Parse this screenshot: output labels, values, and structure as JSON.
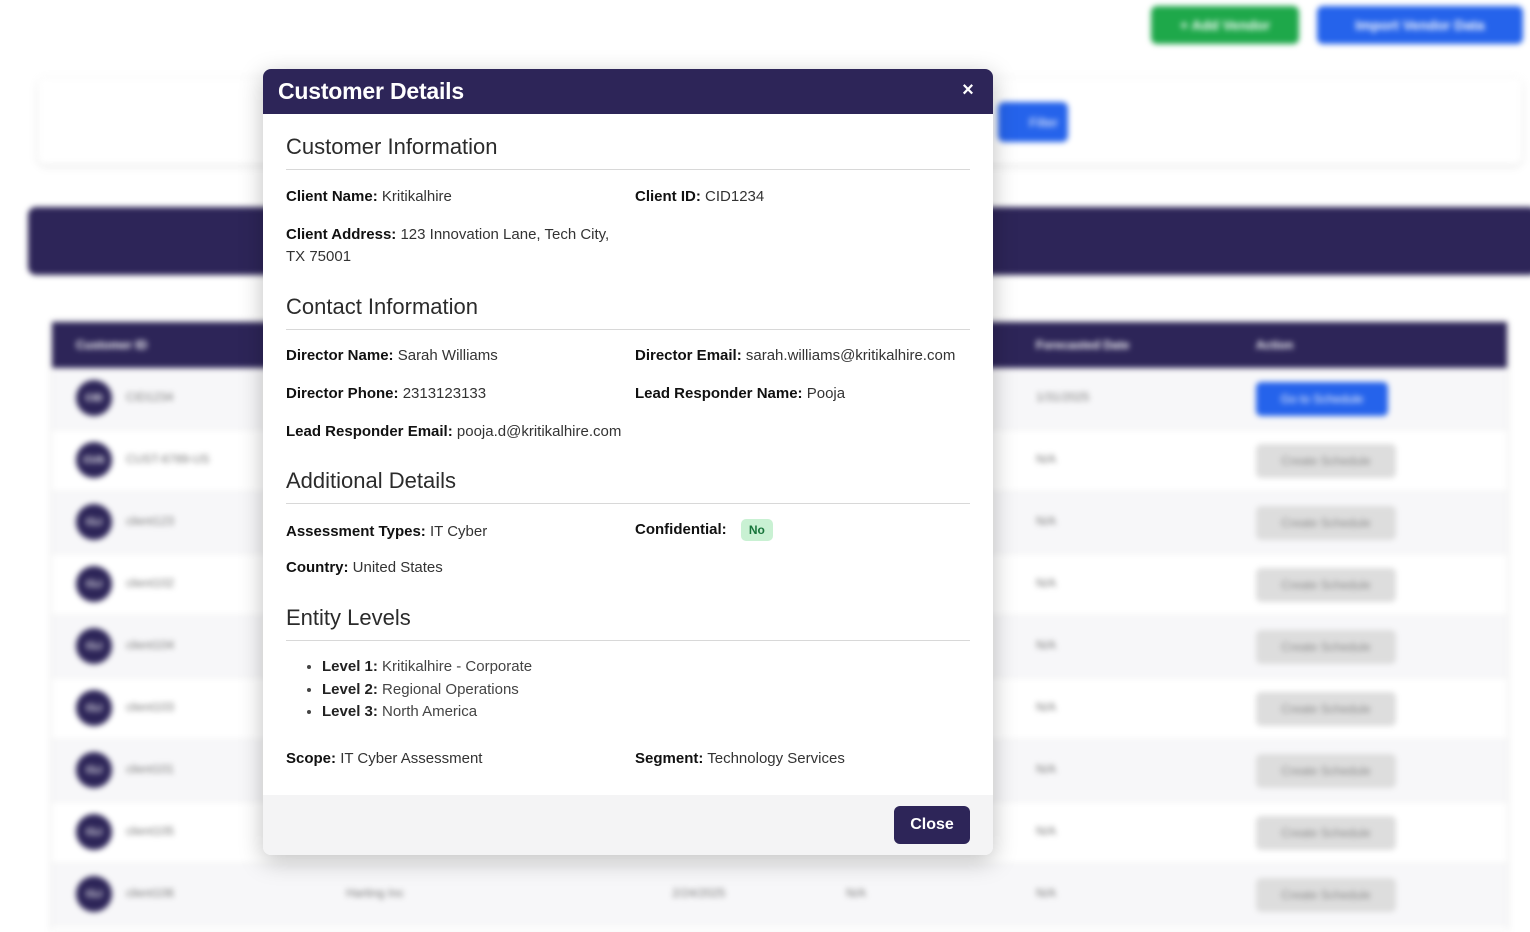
{
  "background": {
    "buttons": {
      "add_vendor": "+ Add Vendor",
      "import_vendor": "Import Vendor Data",
      "filter": "Filter"
    },
    "table": {
      "headers": [
        "Customer ID",
        "Forecasted Date",
        "Action"
      ],
      "rows": [
        {
          "avatar": "CID",
          "id": "CID1234",
          "date": "1/31/2025",
          "action": "Go to Schedule"
        },
        {
          "avatar": "CUS",
          "id": "CUST-6789-US",
          "date": "N/A",
          "action": "Create Schedule"
        },
        {
          "avatar": "CLI",
          "id": "client123",
          "date": "N/A",
          "action": "Create Schedule"
        },
        {
          "avatar": "CLI",
          "id": "client102",
          "date": "N/A",
          "action": "Create Schedule"
        },
        {
          "avatar": "CLI",
          "id": "client104",
          "date": "N/A",
          "action": "Create Schedule"
        },
        {
          "avatar": "CLI",
          "id": "client103",
          "date": "N/A",
          "action": "Create Schedule"
        },
        {
          "avatar": "CLI",
          "id": "client101",
          "date": "N/A",
          "action": "Create Schedule"
        },
        {
          "avatar": "CLI",
          "id": "client105",
          "date": "N/A",
          "action": "Create Schedule"
        },
        {
          "avatar": "CLI",
          "id": "client106",
          "name": "Harting Inc",
          "created": "2/24/2025",
          "status": "N/A",
          "date": "N/A",
          "action": "Create Schedule"
        }
      ]
    }
  },
  "modal": {
    "title": "Customer Details",
    "close_symbol": "×",
    "sections": {
      "customer_info": {
        "title": "Customer Information",
        "client_name_label": "Client Name:",
        "client_name": "Kritikalhire",
        "client_id_label": "Client ID:",
        "client_id": "CID1234",
        "client_address_label": "Client Address:",
        "client_address": "123 Innovation Lane, Tech City, TX 75001"
      },
      "contact_info": {
        "title": "Contact Information",
        "director_name_label": "Director Name:",
        "director_name": "Sarah Williams",
        "director_email_label": "Director Email:",
        "director_email": "sarah.williams@kritikalhire.com",
        "director_phone_label": "Director Phone:",
        "director_phone": "2313123133",
        "lead_name_label": "Lead Responder Name:",
        "lead_name": "Pooja",
        "lead_email_label": "Lead Responder Email:",
        "lead_email": "pooja.d@kritikalhire.com"
      },
      "additional": {
        "title": "Additional Details",
        "assessment_label": "Assessment Types:",
        "assessment": "IT Cyber",
        "confidential_label": "Confidential:",
        "confidential": "No",
        "country_label": "Country:",
        "country": "United States"
      },
      "entity_levels": {
        "title": "Entity Levels",
        "levels": [
          {
            "label": "Level 1:",
            "value": "Kritikalhire - Corporate"
          },
          {
            "label": "Level 2:",
            "value": "Regional Operations"
          },
          {
            "label": "Level 3:",
            "value": "North America"
          }
        ],
        "scope_label": "Scope:",
        "scope": "IT Cyber Assessment",
        "segment_label": "Segment:",
        "segment": "Technology Services"
      }
    },
    "close_button": "Close"
  },
  "colors": {
    "primary_navy": "#2d2558",
    "blue": "#2563eb",
    "green": "#1ea84a",
    "badge_bg": "#c9f1d3",
    "badge_text": "#17743a"
  }
}
